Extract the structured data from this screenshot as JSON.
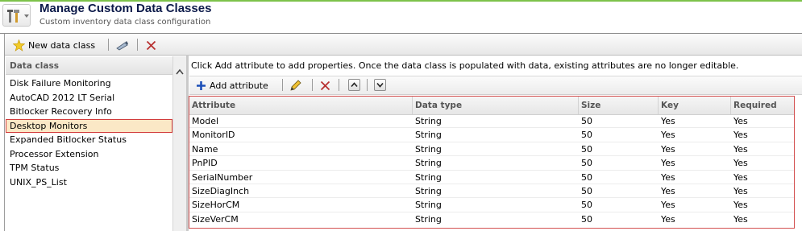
{
  "header": {
    "title": "Manage Custom Data Classes",
    "subtitle": "Custom inventory data class configuration"
  },
  "toolbar": {
    "new_label": "New data class",
    "icons": [
      "new-data-class-icon",
      "edit-icon",
      "delete-icon"
    ]
  },
  "left_panel": {
    "header": "Data class",
    "items": [
      {
        "label": "Disk Failure Monitoring"
      },
      {
        "label": "AutoCAD 2012 LT Serial"
      },
      {
        "label": "Bitlocker Recovery Info"
      },
      {
        "label": "Desktop Monitors"
      },
      {
        "label": "Expanded Bitlocker Status"
      },
      {
        "label": "Processor Extension"
      },
      {
        "label": "TPM Status"
      },
      {
        "label": "UNIX_PS_List"
      }
    ],
    "selected_index": 3
  },
  "right_panel": {
    "info": "Click Add attribute to add properties. Once the data class is populated with data, existing attributes are no longer editable.",
    "add_label": "Add attribute",
    "columns": [
      "Attribute",
      "Data type",
      "Size",
      "Key",
      "Required"
    ],
    "rows": [
      [
        "Model",
        "String",
        "50",
        "Yes",
        "Yes"
      ],
      [
        "MonitorID",
        "String",
        "50",
        "Yes",
        "Yes"
      ],
      [
        "Name",
        "String",
        "50",
        "Yes",
        "Yes"
      ],
      [
        "PnPID",
        "String",
        "50",
        "Yes",
        "Yes"
      ],
      [
        "SerialNumber",
        "String",
        "50",
        "Yes",
        "Yes"
      ],
      [
        "SizeDiagInch",
        "String",
        "50",
        "Yes",
        "Yes"
      ],
      [
        "SizeHorCM",
        "String",
        "50",
        "Yes",
        "Yes"
      ],
      [
        "SizeVerCM",
        "String",
        "50",
        "Yes",
        "Yes"
      ]
    ]
  },
  "colors": {
    "accent_green": "#7dc24a",
    "selection_fill": "#fbe8c6",
    "highlight_border": "#d23c3c",
    "title_color": "#0c1a4a",
    "add_icon": "#1c4fb8"
  }
}
